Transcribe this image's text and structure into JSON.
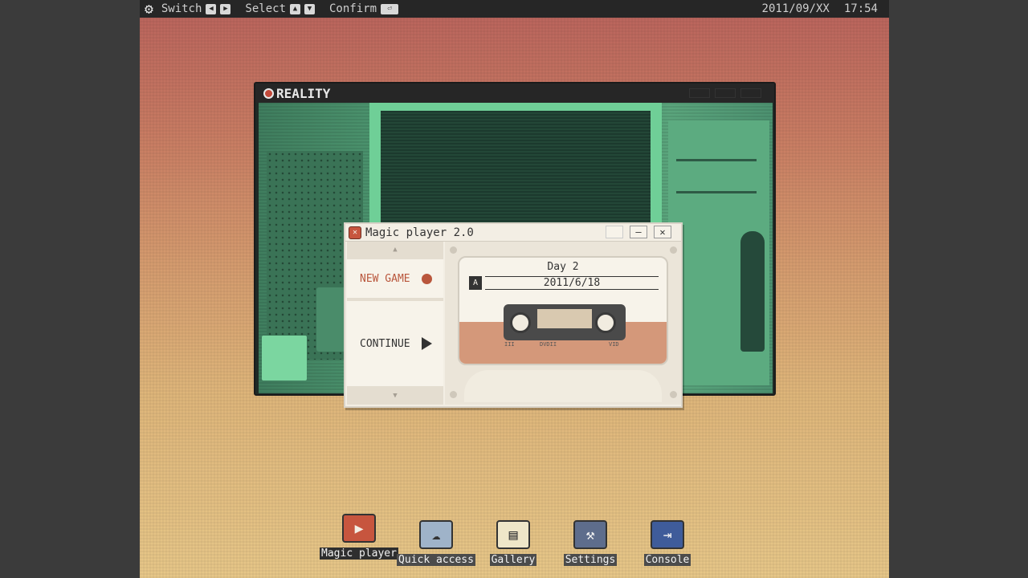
{
  "topbar": {
    "switch_label": "Switch",
    "select_label": "Select",
    "confirm_label": "Confirm",
    "date": "2011/09/XX",
    "time": "17:54"
  },
  "reality_window": {
    "title": "REALITY"
  },
  "magic_player": {
    "title": "Magic player 2.0",
    "menu": {
      "new_game": "NEW GAME",
      "continue": "CONTINUE"
    },
    "save": {
      "day": "Day 2",
      "date": "2011/6/18",
      "tape_text_left": "III",
      "tape_text_mid": "DVDII",
      "tape_text_right": "VID"
    }
  },
  "dock": [
    {
      "label": "Magic player",
      "icon": "film-icon"
    },
    {
      "label": "Quick access",
      "icon": "cloud-icon"
    },
    {
      "label": "Gallery",
      "icon": "notebook-icon"
    },
    {
      "label": "Settings",
      "icon": "wrench-icon"
    },
    {
      "label": "Console",
      "icon": "exit-icon"
    }
  ],
  "colors": {
    "accent": "#b9563c",
    "dock_active": "#c7553e"
  }
}
